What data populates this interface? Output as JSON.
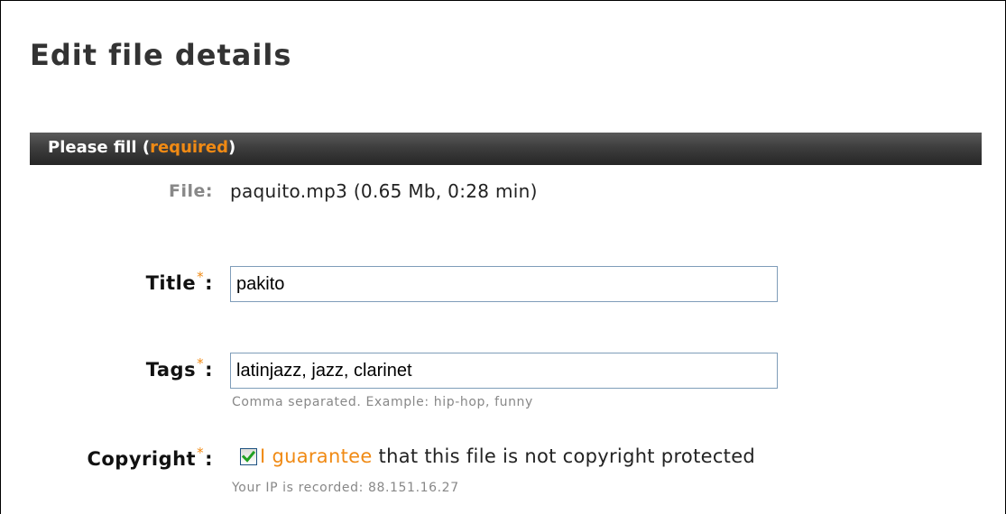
{
  "page": {
    "title": "Edit file details"
  },
  "section": {
    "prefix": "Please fill (",
    "required_word": "required",
    "suffix": ")"
  },
  "file": {
    "label": "File:",
    "value": "paquito.mp3 (0.65 Mb, 0:28 min)"
  },
  "title_field": {
    "label": "Title",
    "required_mark": "*",
    "colon": ":",
    "value": "pakito"
  },
  "tags_field": {
    "label": "Tags",
    "required_mark": "*",
    "colon": ":",
    "value": "latinjazz, jazz, clarinet",
    "hint": "Comma separated. Example: hip-hop, funny"
  },
  "copyright": {
    "label": "Copyright",
    "required_mark": "*",
    "colon": ":",
    "checked": true,
    "link_text": "I guarantee",
    "text": " that this file is not copyright protected",
    "ip_note": "Your IP is recorded: 88.151.16.27"
  },
  "colors": {
    "accent": "#f08a14",
    "header_bar": "#333333",
    "checkmark": "#21a121"
  },
  "icons": {
    "checkbox": "checkmark-icon"
  }
}
